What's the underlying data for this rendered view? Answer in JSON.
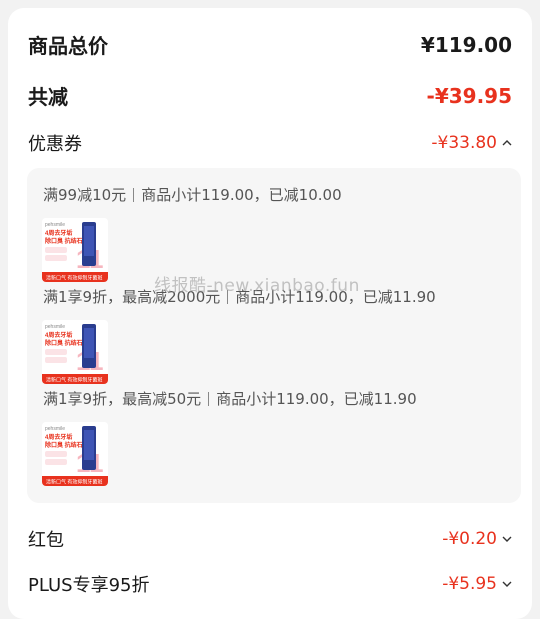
{
  "summary": {
    "total_label": "商品总价",
    "total_value": "¥119.00",
    "reduce_label": "共减",
    "reduce_value": "-¥39.95"
  },
  "coupon": {
    "label": "优惠券",
    "value": "-¥33.80",
    "items": [
      {
        "rule": "满99减10元",
        "detail": "商品小计119.00，已减10.00"
      },
      {
        "rule": "满1享9折，最高减2000元",
        "detail": "商品小计119.00，已减11.90"
      },
      {
        "rule": "满1享9折，最高减50元",
        "detail": "商品小计119.00，已减11.90"
      }
    ]
  },
  "product_thumb": {
    "brand": "pehsmile",
    "line1": "4周去牙垢",
    "line2": "除口臭 抗结石",
    "footer": "清新口气 有效抑制牙菌斑"
  },
  "watermark": "线报酷-new.xianbao.fun",
  "red_packet": {
    "label": "红包",
    "value": "-¥0.20"
  },
  "plus": {
    "label": "PLUS专享95折",
    "value": "-¥5.95"
  },
  "colors": {
    "accent_red": "#e8321e",
    "text": "#1a1a1a",
    "panel": "#f6f6f6"
  },
  "icons": {
    "coupon_toggle": "chevron-up-icon",
    "expand": "chevron-down-icon"
  }
}
